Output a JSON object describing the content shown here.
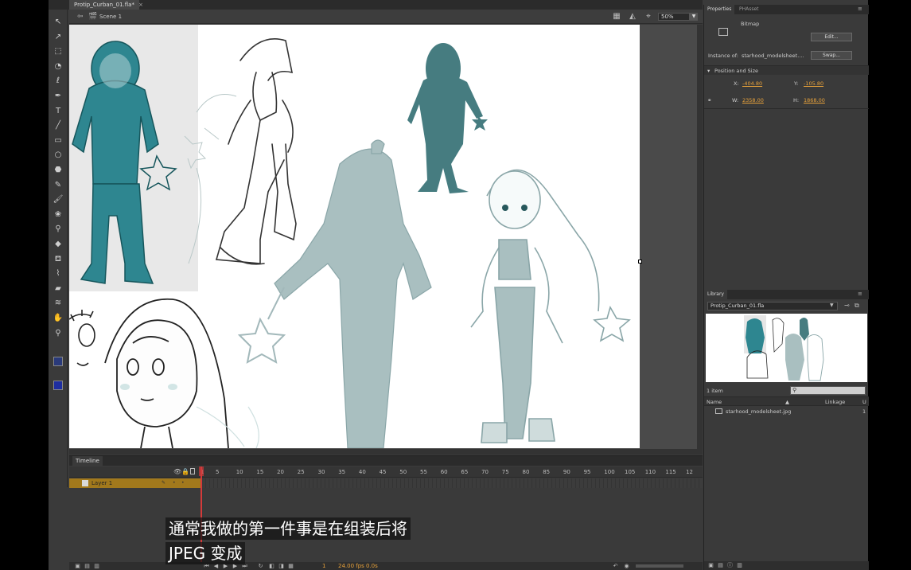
{
  "document": {
    "tab_title": "Protip_Curban_01.fla*",
    "close_glyph": "×"
  },
  "scene": {
    "label": "Scene 1",
    "zoom": "50%"
  },
  "tools": [
    {
      "name": "selection-tool",
      "glyph": "↖"
    },
    {
      "name": "subselection-tool",
      "glyph": "↗"
    },
    {
      "name": "free-transform-tool",
      "glyph": "⬚"
    },
    {
      "name": "3d-rotation-tool",
      "glyph": "◔"
    },
    {
      "name": "lasso-tool",
      "glyph": "ℓ"
    },
    {
      "name": "pen-tool",
      "glyph": "✒"
    },
    {
      "name": "text-tool",
      "glyph": "T"
    },
    {
      "name": "line-tool",
      "glyph": "╱"
    },
    {
      "name": "rectangle-tool",
      "glyph": "▭"
    },
    {
      "name": "oval-tool",
      "glyph": "○"
    },
    {
      "name": "polystar-tool",
      "glyph": "⬣"
    },
    {
      "name": "pencil-tool",
      "glyph": "✎"
    },
    {
      "name": "brush-tool",
      "glyph": "🖌"
    },
    {
      "name": "deco-tool",
      "glyph": "❀"
    },
    {
      "name": "bone-tool",
      "glyph": "⚲"
    },
    {
      "name": "paint-bucket-tool",
      "glyph": "◆"
    },
    {
      "name": "ink-bottle-tool",
      "glyph": "⛾"
    },
    {
      "name": "eyedropper-tool",
      "glyph": "⌇"
    },
    {
      "name": "eraser-tool",
      "glyph": "▰"
    },
    {
      "name": "width-tool",
      "glyph": "≋"
    },
    {
      "name": "hand-tool",
      "glyph": "✋"
    },
    {
      "name": "zoom-tool",
      "glyph": "⚲"
    }
  ],
  "colors": {
    "stroke": "#2a3a7a",
    "fill": "#1e2ea0",
    "teal": "#2e8690",
    "grey_teal": "#93aeae",
    "light_teal": "#c5dada"
  },
  "timeline": {
    "title": "Timeline",
    "layer_name": "Layer 1",
    "frame_numbers": [
      "1",
      "5",
      "10",
      "15",
      "20",
      "25",
      "30",
      "35",
      "40",
      "45",
      "50",
      "55",
      "60",
      "65",
      "70",
      "75",
      "80",
      "85",
      "90",
      "95",
      "100",
      "105",
      "110",
      "115",
      "12"
    ],
    "current_frame": "1",
    "elapsed": "0.0s",
    "fps": "24.00 fps"
  },
  "properties": {
    "tabs": [
      "Properties",
      "PHAsset"
    ],
    "type_label": "Bitmap",
    "edit_button": "Edit...",
    "instance_label": "Instance of:",
    "instance_value": "starhood_modelsheet....",
    "swap_button": "Swap...",
    "section": "Position and Size",
    "x_label": "X:",
    "x_value": "-404.80",
    "y_label": "Y:",
    "y_value": "-105.80",
    "w_label": "W:",
    "w_value": "2358.00",
    "h_label": "H:",
    "h_value": "1868.00"
  },
  "library": {
    "tab": "Library",
    "file": "Protip_Curban_01.fla",
    "count": "1 item",
    "col_name": "Name",
    "col_linkage": "Linkage",
    "col_use": "U",
    "item_name": "starhood_modelsheet.jpg",
    "item_use": "1"
  },
  "subtitles": {
    "line1": "通常我做的第一件事是在组装后将",
    "line2": "JPEG 变成"
  }
}
